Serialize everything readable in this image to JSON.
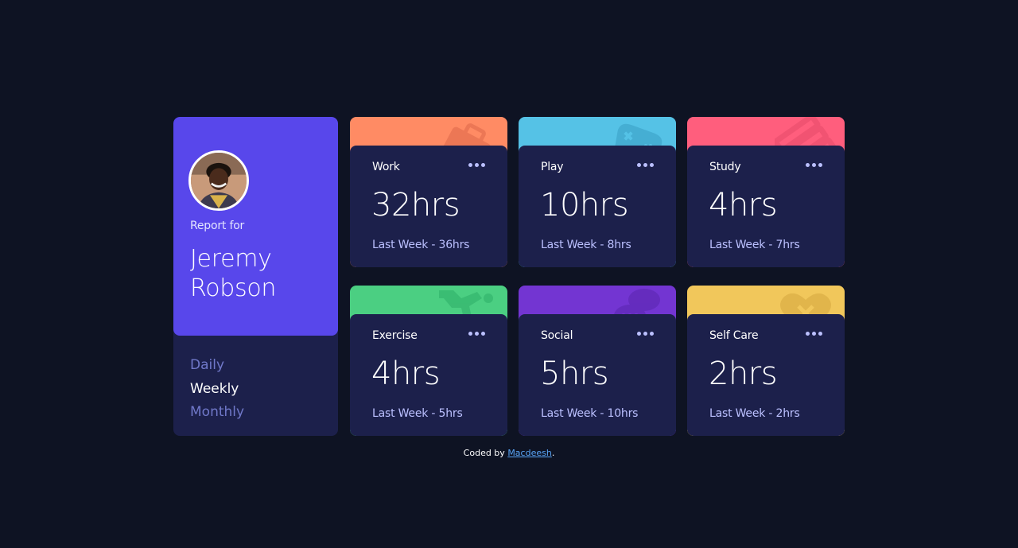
{
  "profile": {
    "report_label": "Report for",
    "name": "Jeremy Robson",
    "avatar_icon": "user-photo"
  },
  "timeframes": [
    {
      "label": "Daily",
      "active": false
    },
    {
      "label": "Weekly",
      "active": true
    },
    {
      "label": "Monthly",
      "active": false
    }
  ],
  "cards": [
    {
      "title": "Work",
      "hours": "32hrs",
      "previous": "Last Week - 36hrs",
      "color": "#ff8b64",
      "icon": "briefcase-icon"
    },
    {
      "title": "Play",
      "hours": "10hrs",
      "previous": "Last Week - 8hrs",
      "color": "#55c2e6",
      "icon": "gamepad-icon"
    },
    {
      "title": "Study",
      "hours": "4hrs",
      "previous": "Last Week - 7hrs",
      "color": "#ff5e7d",
      "icon": "books-icon"
    },
    {
      "title": "Exercise",
      "hours": "4hrs",
      "previous": "Last Week - 5hrs",
      "color": "#4bcf82",
      "icon": "runner-icon"
    },
    {
      "title": "Social",
      "hours": "5hrs",
      "previous": "Last Week - 10hrs",
      "color": "#7335d2",
      "icon": "chat-icon"
    },
    {
      "title": "Self Care",
      "hours": "2hrs",
      "previous": "Last Week - 2hrs",
      "color": "#f1c75b",
      "icon": "heart-icon"
    }
  ],
  "footer": {
    "prefix": "Coded by",
    "link_text": "Macdeesh",
    "suffix": "."
  },
  "colors": {
    "background": "#0e1323",
    "card": "#1c204b",
    "accent": "#5847eb",
    "muted_text": "#bbc0ff"
  }
}
